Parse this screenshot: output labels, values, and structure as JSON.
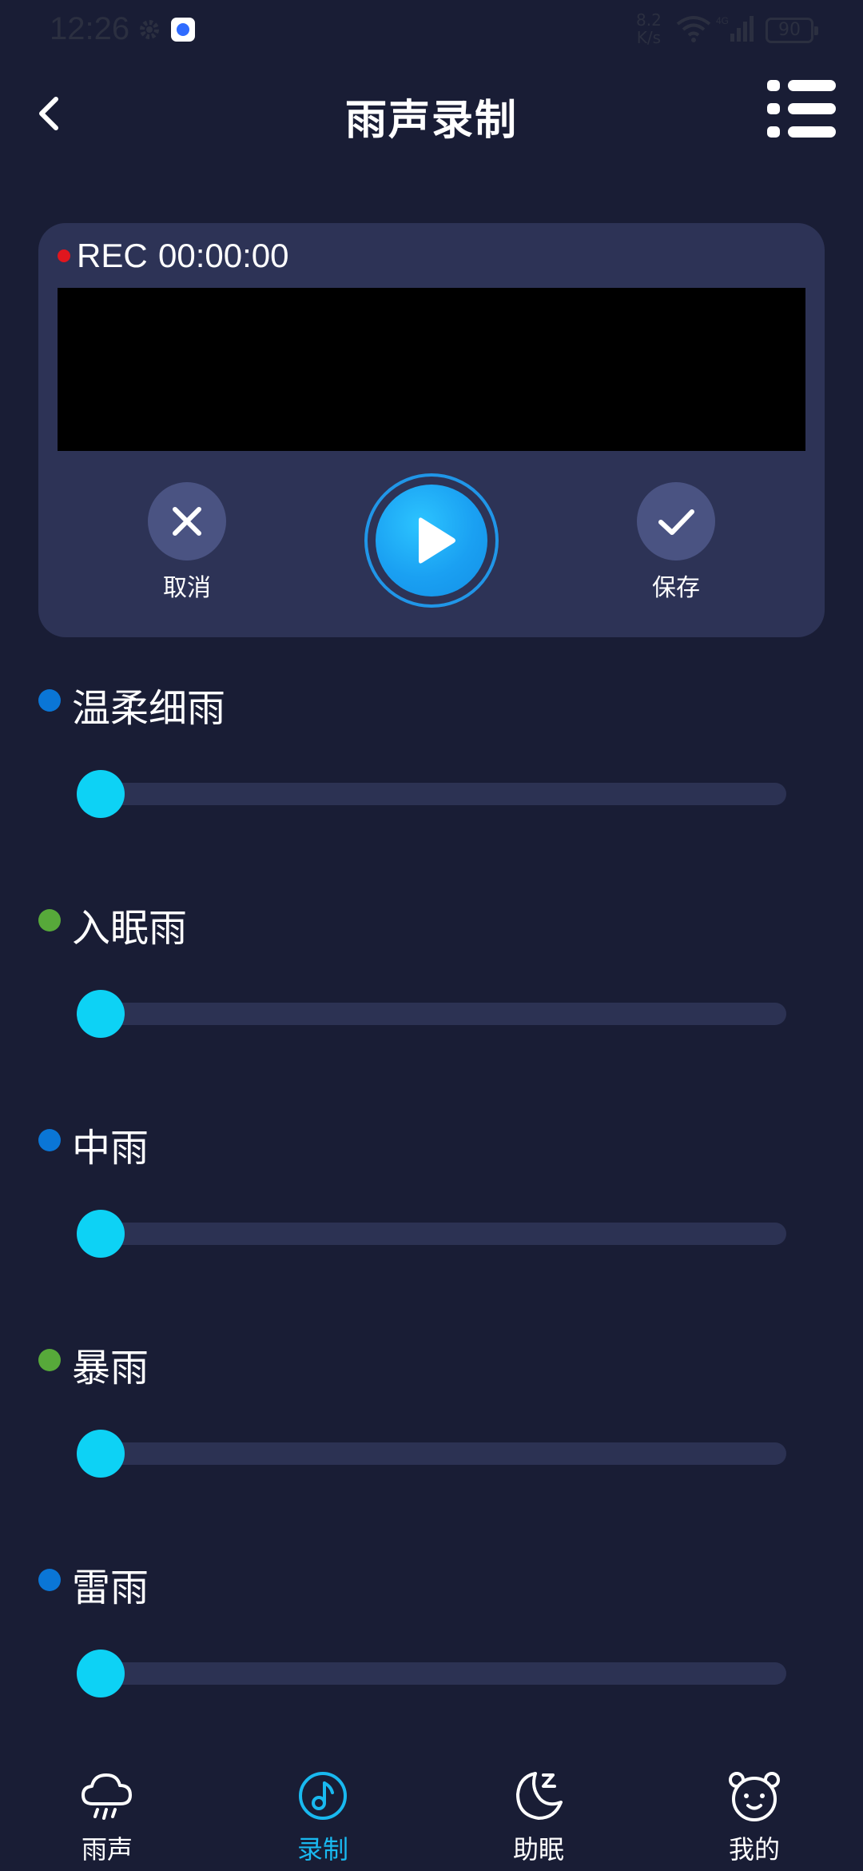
{
  "status_bar": {
    "time": "12:26",
    "net_speed_value": "8.2",
    "net_speed_unit": "K/s",
    "network_type": "4G",
    "battery": "90"
  },
  "header": {
    "title": "雨声录制",
    "back_icon": "chevron-left-icon",
    "menu_icon": "list-icon"
  },
  "recorder": {
    "rec_label": "REC",
    "elapsed": "00:00:00",
    "cancel_label": "取消",
    "save_label": "保存",
    "play_icon": "play-icon"
  },
  "sounds": [
    {
      "name": "温柔细雨",
      "dot_color": "#0a76d6",
      "level": 0
    },
    {
      "name": "入眠雨",
      "dot_color": "#57a93a",
      "level": 0
    },
    {
      "name": "中雨",
      "dot_color": "#0a76d6",
      "level": 0
    },
    {
      "name": "暴雨",
      "dot_color": "#57a93a",
      "level": 0
    },
    {
      "name": "雷雨",
      "dot_color": "#0a76d6",
      "level": 0
    }
  ],
  "colors": {
    "background": "#191d35",
    "card": "#2d3356",
    "accent": "#19b9f0",
    "slider_thumb": "#0dd2f5",
    "rec_dot": "#e0161e"
  },
  "bottom_nav": [
    {
      "label": "雨声",
      "icon": "rain-cloud-icon",
      "active": false
    },
    {
      "label": "录制",
      "icon": "music-note-icon",
      "active": true
    },
    {
      "label": "助眠",
      "icon": "moon-sleep-icon",
      "active": false
    },
    {
      "label": "我的",
      "icon": "bear-face-icon",
      "active": false
    }
  ]
}
